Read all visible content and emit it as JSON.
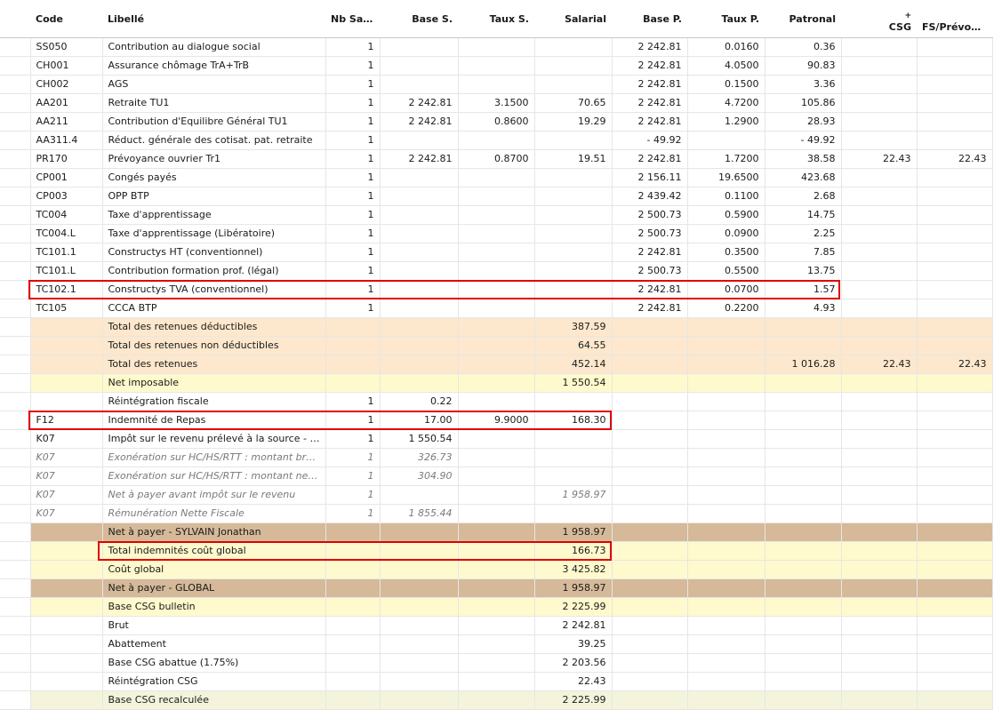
{
  "columns": {
    "code": "Code",
    "libelle": "Libellé",
    "nb_salaries": "Nb Sala...",
    "base_s": "Base S.",
    "taux_s": "Taux S.",
    "salarial": "Salarial",
    "base_p": "Base P.",
    "taux_p": "Taux P.",
    "patronal": "Patronal",
    "csg_prefix": "+",
    "csg": "CSG",
    "fs_prevoyance": "FS/Prévoyan..."
  },
  "rows": [
    {
      "style": "plain",
      "code": "SS050",
      "libelle": "Contribution au dialogue social",
      "nb": "1",
      "base_s": "",
      "taux_s": "",
      "salarial": "",
      "base_p": "2 242.81",
      "taux_p": "0.0160",
      "patronal": "0.36",
      "csg": "",
      "fs": ""
    },
    {
      "style": "plain",
      "code": "CH001",
      "libelle": "Assurance chômage TrA+TrB",
      "nb": "1",
      "base_s": "",
      "taux_s": "",
      "salarial": "",
      "base_p": "2 242.81",
      "taux_p": "4.0500",
      "patronal": "90.83",
      "csg": "",
      "fs": ""
    },
    {
      "style": "plain",
      "code": "CH002",
      "libelle": "AGS",
      "nb": "1",
      "base_s": "",
      "taux_s": "",
      "salarial": "",
      "base_p": "2 242.81",
      "taux_p": "0.1500",
      "patronal": "3.36",
      "csg": "",
      "fs": ""
    },
    {
      "style": "plain",
      "code": "AA201",
      "libelle": "Retraite TU1",
      "nb": "1",
      "base_s": "2 242.81",
      "taux_s": "3.1500",
      "salarial": "70.65",
      "base_p": "2 242.81",
      "taux_p": "4.7200",
      "patronal": "105.86",
      "csg": "",
      "fs": ""
    },
    {
      "style": "plain",
      "code": "AA211",
      "libelle": "Contribution d'Equilibre Général TU1",
      "nb": "1",
      "base_s": "2 242.81",
      "taux_s": "0.8600",
      "salarial": "19.29",
      "base_p": "2 242.81",
      "taux_p": "1.2900",
      "patronal": "28.93",
      "csg": "",
      "fs": ""
    },
    {
      "style": "plain",
      "code": "AA311.4",
      "libelle": "Réduct. générale des cotisat. pat. retraite",
      "nb": "1",
      "base_s": "",
      "taux_s": "",
      "salarial": "",
      "base_p": "- 49.92",
      "taux_p": "",
      "patronal": "- 49.92",
      "csg": "",
      "fs": ""
    },
    {
      "style": "plain",
      "code": "PR170",
      "libelle": "Prévoyance ouvrier Tr1",
      "nb": "1",
      "base_s": "2 242.81",
      "taux_s": "0.8700",
      "salarial": "19.51",
      "base_p": "2 242.81",
      "taux_p": "1.7200",
      "patronal": "38.58",
      "csg": "22.43",
      "fs": "22.43"
    },
    {
      "style": "plain",
      "code": "CP001",
      "libelle": "Congés payés",
      "nb": "1",
      "base_s": "",
      "taux_s": "",
      "salarial": "",
      "base_p": "2 156.11",
      "taux_p": "19.6500",
      "patronal": "423.68",
      "csg": "",
      "fs": ""
    },
    {
      "style": "plain",
      "code": "CP003",
      "libelle": "OPP BTP",
      "nb": "1",
      "base_s": "",
      "taux_s": "",
      "salarial": "",
      "base_p": "2 439.42",
      "taux_p": "0.1100",
      "patronal": "2.68",
      "csg": "",
      "fs": ""
    },
    {
      "style": "plain",
      "code": "TC004",
      "libelle": "Taxe d'apprentissage",
      "nb": "1",
      "base_s": "",
      "taux_s": "",
      "salarial": "",
      "base_p": "2 500.73",
      "taux_p": "0.5900",
      "patronal": "14.75",
      "csg": "",
      "fs": ""
    },
    {
      "style": "plain",
      "code": "TC004.L",
      "libelle": "Taxe d'apprentissage (Libératoire)",
      "nb": "1",
      "base_s": "",
      "taux_s": "",
      "salarial": "",
      "base_p": "2 500.73",
      "taux_p": "0.0900",
      "patronal": "2.25",
      "csg": "",
      "fs": ""
    },
    {
      "style": "plain",
      "code": "TC101.1",
      "libelle": "Constructys HT (conventionnel)",
      "nb": "1",
      "base_s": "",
      "taux_s": "",
      "salarial": "",
      "base_p": "2 242.81",
      "taux_p": "0.3500",
      "patronal": "7.85",
      "csg": "",
      "fs": ""
    },
    {
      "style": "plain",
      "code": "TC101.L",
      "libelle": "Contribution formation prof. (légal)",
      "nb": "1",
      "base_s": "",
      "taux_s": "",
      "salarial": "",
      "base_p": "2 500.73",
      "taux_p": "0.5500",
      "patronal": "13.75",
      "csg": "",
      "fs": ""
    },
    {
      "style": "plain",
      "code": "TC102.1",
      "libelle": "Constructys TVA (conventionnel)",
      "nb": "1",
      "base_s": "",
      "taux_s": "",
      "salarial": "",
      "base_p": "2 242.81",
      "taux_p": "0.0700",
      "patronal": "1.57",
      "csg": "",
      "fs": ""
    },
    {
      "style": "plain",
      "code": "TC105",
      "libelle": "CCCA BTP",
      "nb": "1",
      "base_s": "",
      "taux_s": "",
      "salarial": "",
      "base_p": "2 242.81",
      "taux_p": "0.2200",
      "patronal": "4.93",
      "csg": "",
      "fs": ""
    },
    {
      "style": "peach",
      "code": "",
      "libelle": "Total des retenues déductibles",
      "nb": "",
      "base_s": "",
      "taux_s": "",
      "salarial": "387.59",
      "base_p": "",
      "taux_p": "",
      "patronal": "",
      "csg": "",
      "fs": ""
    },
    {
      "style": "peach",
      "code": "",
      "libelle": "Total des retenues non déductibles",
      "nb": "",
      "base_s": "",
      "taux_s": "",
      "salarial": "64.55",
      "base_p": "",
      "taux_p": "",
      "patronal": "",
      "csg": "",
      "fs": ""
    },
    {
      "style": "peach",
      "code": "",
      "libelle": "Total des retenues",
      "nb": "",
      "base_s": "",
      "taux_s": "",
      "salarial": "452.14",
      "base_p": "",
      "taux_p": "",
      "patronal": "1 016.28",
      "csg": "22.43",
      "fs": "22.43"
    },
    {
      "style": "cream",
      "code": "",
      "libelle": "Net imposable",
      "nb": "",
      "base_s": "",
      "taux_s": "",
      "salarial": "1 550.54",
      "base_p": "",
      "taux_p": "",
      "patronal": "",
      "csg": "",
      "fs": ""
    },
    {
      "style": "plain",
      "code": "",
      "libelle": "Réintégration fiscale",
      "nb": "1",
      "base_s": "0.22",
      "taux_s": "",
      "salarial": "",
      "base_p": "",
      "taux_p": "",
      "patronal": "",
      "csg": "",
      "fs": ""
    },
    {
      "style": "plain",
      "code": "F12",
      "libelle": "Indemnité de Repas",
      "nb": "1",
      "base_s": "17.00",
      "taux_s": "9.9000",
      "salarial": "168.30",
      "base_p": "",
      "taux_p": "",
      "patronal": "",
      "csg": "",
      "fs": ""
    },
    {
      "style": "plain",
      "code": "K07",
      "libelle": "Impôt sur le revenu prélevé à la source - PAS",
      "nb": "1",
      "base_s": "1 550.54",
      "taux_s": "",
      "salarial": "",
      "base_p": "",
      "taux_p": "",
      "patronal": "",
      "csg": "",
      "fs": ""
    },
    {
      "style": "italic",
      "code": "K07",
      "libelle": "Exonération sur HC/HS/RTT : montant brut dé...",
      "nb": "1",
      "base_s": "326.73",
      "taux_s": "",
      "salarial": "",
      "base_p": "",
      "taux_p": "",
      "patronal": "",
      "csg": "",
      "fs": ""
    },
    {
      "style": "italic",
      "code": "K07",
      "libelle": "Exonération sur HC/HS/RTT : montant net fiscal",
      "nb": "1",
      "base_s": "304.90",
      "taux_s": "",
      "salarial": "",
      "base_p": "",
      "taux_p": "",
      "patronal": "",
      "csg": "",
      "fs": ""
    },
    {
      "style": "italic",
      "code": "K07",
      "libelle": "Net à payer avant impôt sur le revenu",
      "nb": "1",
      "base_s": "",
      "taux_s": "",
      "salarial": "1 958.97",
      "base_p": "",
      "taux_p": "",
      "patronal": "",
      "csg": "",
      "fs": ""
    },
    {
      "style": "italic",
      "code": "K07",
      "libelle": "Rémunération Nette Fiscale",
      "nb": "1",
      "base_s": "1 855.44",
      "taux_s": "",
      "salarial": "",
      "base_p": "",
      "taux_p": "",
      "patronal": "",
      "csg": "",
      "fs": ""
    },
    {
      "style": "tan",
      "code": "",
      "libelle": "Net à payer - SYLVAIN Jonathan",
      "nb": "",
      "base_s": "",
      "taux_s": "",
      "salarial": "1 958.97",
      "base_p": "",
      "taux_p": "",
      "patronal": "",
      "csg": "",
      "fs": ""
    },
    {
      "style": "cream",
      "code": "",
      "libelle": "Total indemnités coût global",
      "nb": "",
      "base_s": "",
      "taux_s": "",
      "salarial": "166.73",
      "base_p": "",
      "taux_p": "",
      "patronal": "",
      "csg": "",
      "fs": ""
    },
    {
      "style": "cream",
      "code": "",
      "libelle": "Coût global",
      "nb": "",
      "base_s": "",
      "taux_s": "",
      "salarial": "3 425.82",
      "base_p": "",
      "taux_p": "",
      "patronal": "",
      "csg": "",
      "fs": ""
    },
    {
      "style": "tan",
      "code": "",
      "libelle": "Net à payer - GLOBAL",
      "nb": "",
      "base_s": "",
      "taux_s": "",
      "salarial": "1 958.97",
      "base_p": "",
      "taux_p": "",
      "patronal": "",
      "csg": "",
      "fs": ""
    },
    {
      "style": "cream",
      "code": "",
      "libelle": "Base CSG bulletin",
      "nb": "",
      "base_s": "",
      "taux_s": "",
      "salarial": "2 225.99",
      "base_p": "",
      "taux_p": "",
      "patronal": "",
      "csg": "",
      "fs": ""
    },
    {
      "style": "plain",
      "code": "",
      "libelle": "Brut",
      "nb": "",
      "base_s": "",
      "taux_s": "",
      "salarial": "2 242.81",
      "base_p": "",
      "taux_p": "",
      "patronal": "",
      "csg": "",
      "fs": ""
    },
    {
      "style": "plain",
      "code": "",
      "libelle": "Abattement",
      "nb": "",
      "base_s": "",
      "taux_s": "",
      "salarial": "39.25",
      "base_p": "",
      "taux_p": "",
      "patronal": "",
      "csg": "",
      "fs": ""
    },
    {
      "style": "plain",
      "code": "",
      "libelle": "Base CSG abattue (1.75%)",
      "nb": "",
      "base_s": "",
      "taux_s": "",
      "salarial": "2 203.56",
      "base_p": "",
      "taux_p": "",
      "patronal": "",
      "csg": "",
      "fs": ""
    },
    {
      "style": "plain",
      "code": "",
      "libelle": "Réintégration CSG",
      "nb": "",
      "base_s": "",
      "taux_s": "",
      "salarial": "22.43",
      "base_p": "",
      "taux_p": "",
      "patronal": "",
      "csg": "",
      "fs": ""
    },
    {
      "style": "lightgreen",
      "code": "",
      "libelle": "Base CSG recalculée",
      "nb": "",
      "base_s": "",
      "taux_s": "",
      "salarial": "2 225.99",
      "base_p": "",
      "taux_p": "",
      "patronal": "",
      "csg": "",
      "fs": ""
    }
  ],
  "colors": {
    "highlight": "#e00000",
    "peach": "#fde8cd",
    "cream": "#fefacd",
    "tan": "#d5b999",
    "lightgreen": "#f4f4dc"
  }
}
